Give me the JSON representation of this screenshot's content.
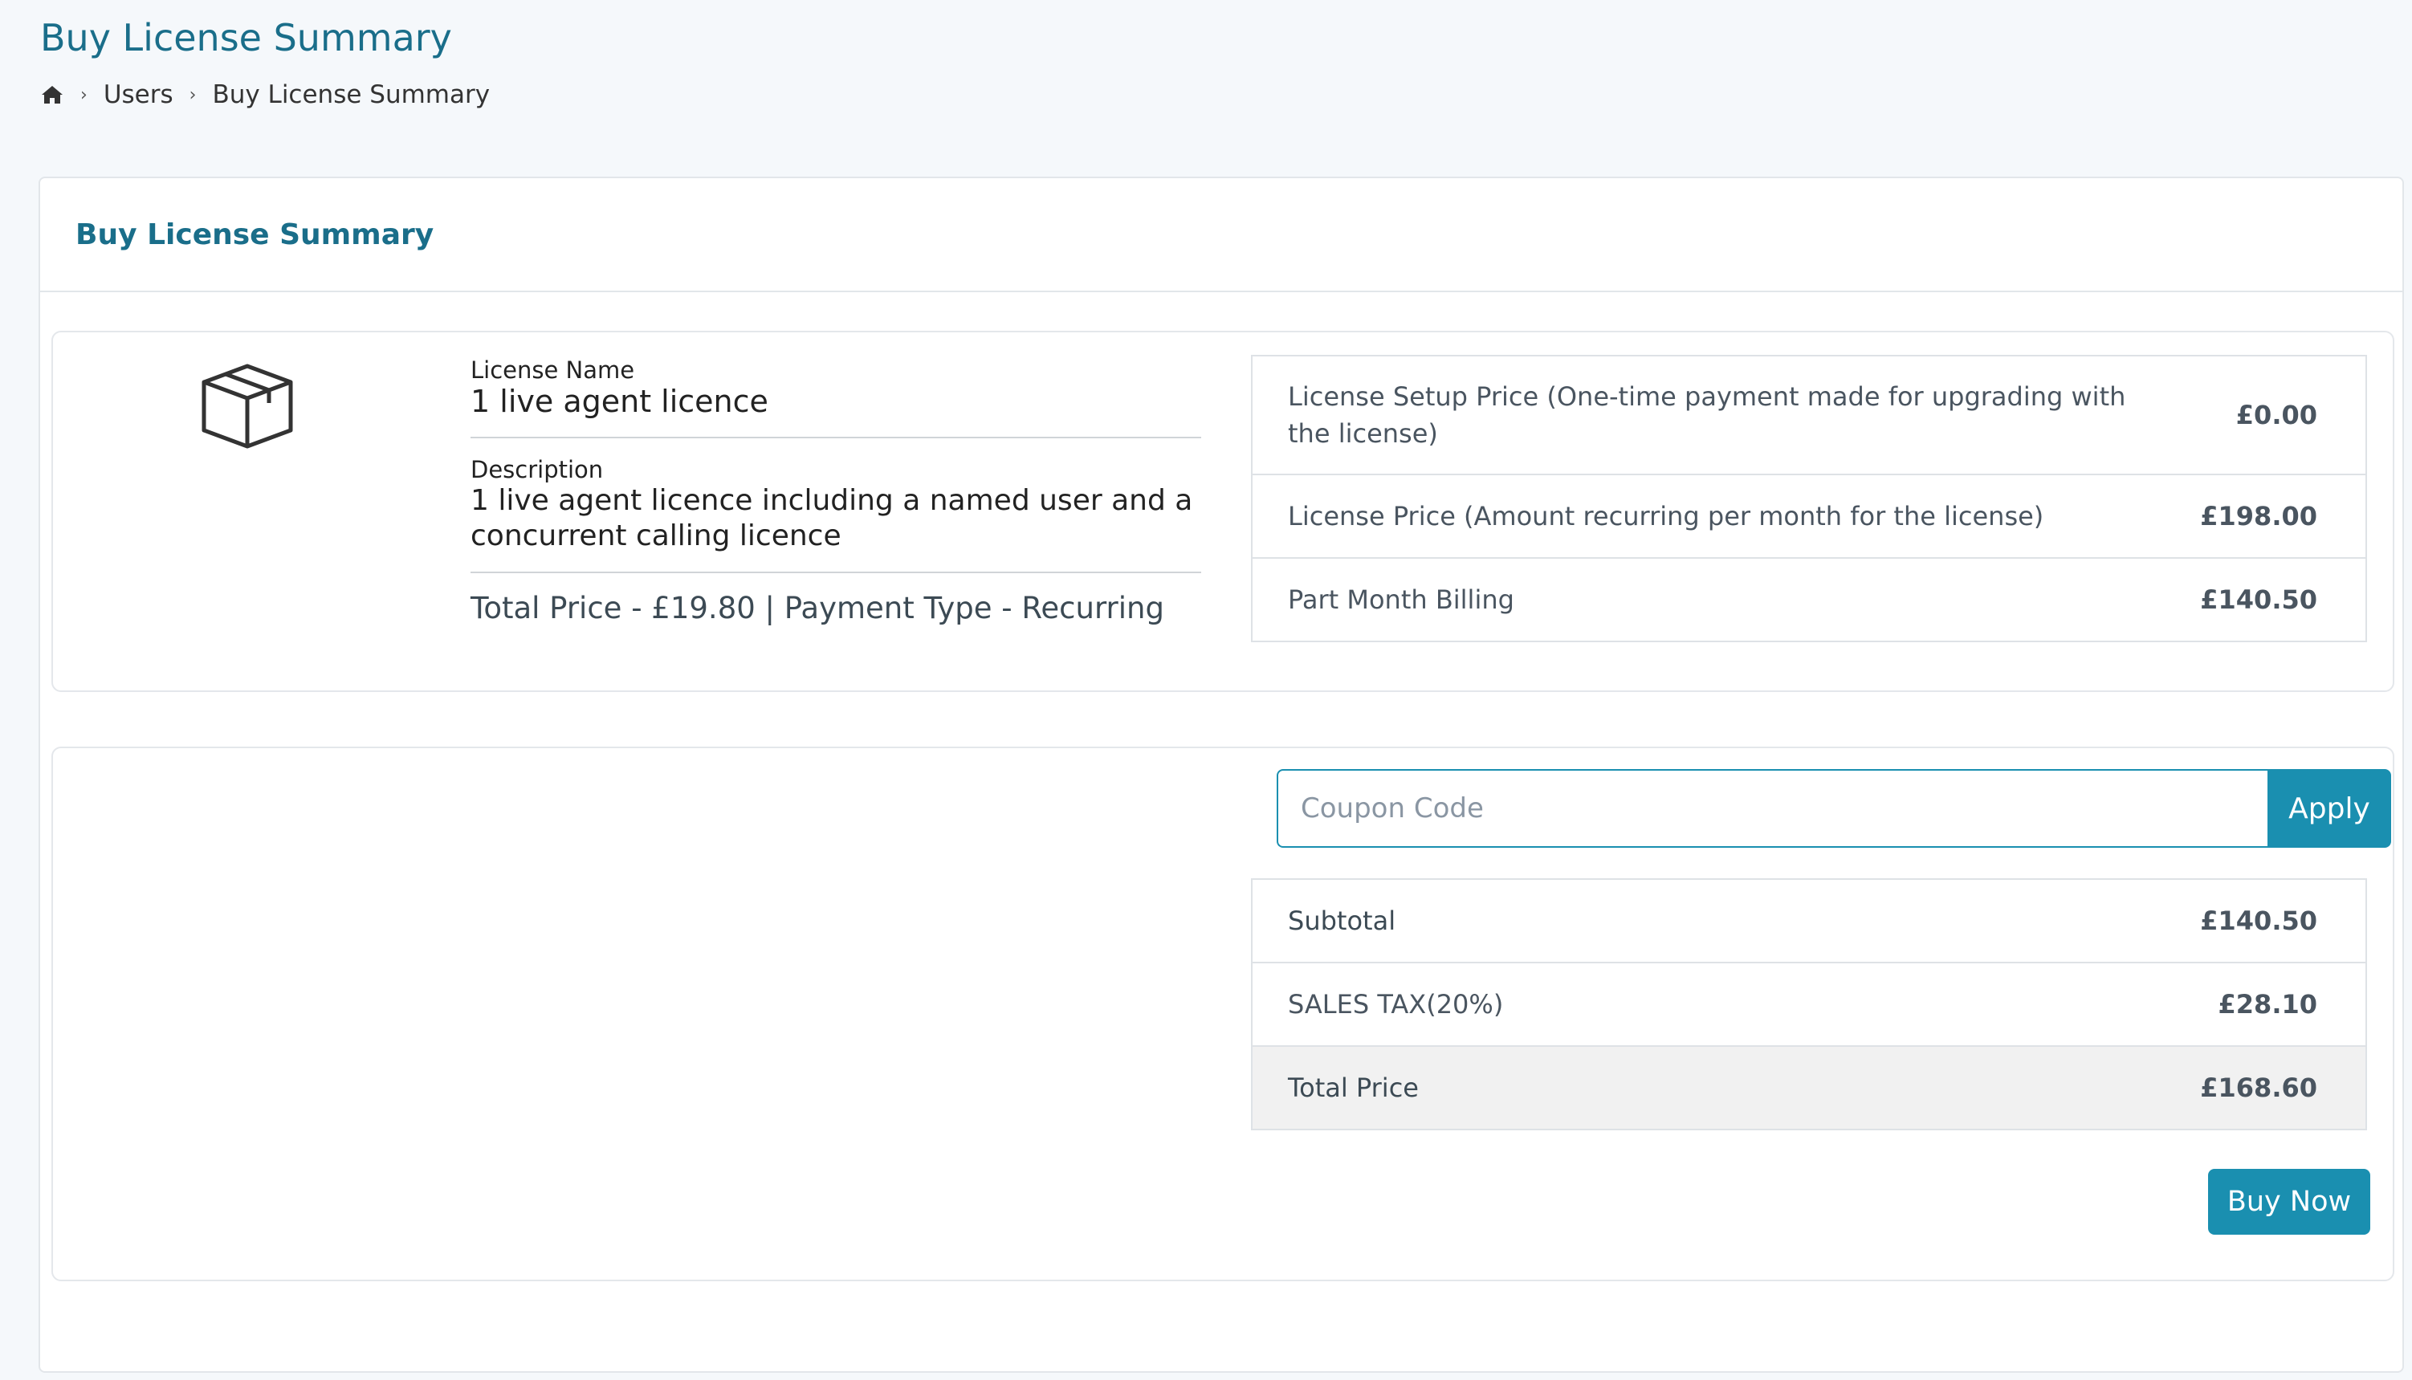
{
  "page": {
    "title": "Buy License Summary",
    "breadcrumb": {
      "home_icon": "home-icon",
      "items": [
        "Users",
        "Buy License Summary"
      ]
    }
  },
  "card": {
    "header": "Buy License Summary"
  },
  "license": {
    "icon": "package-box-icon",
    "name_label": "License Name",
    "name": "1 live agent licence",
    "description_label": "Description",
    "description": "1 live agent licence including a named user and a concurrent calling licence",
    "total_price_label": "Total Price",
    "total_price_value": " - £19.80 | ",
    "payment_type_label": "Payment Type",
    "payment_type_value": " - Recurring"
  },
  "pricing": [
    {
      "label": "License Setup Price (One-time payment made for upgrading with the license)",
      "value": "£0.00"
    },
    {
      "label": "License Price (Amount recurring per month for the license)",
      "value": "£198.00"
    },
    {
      "label": "Part Month Billing",
      "value": "£140.50"
    }
  ],
  "coupon": {
    "placeholder": "Coupon Code",
    "value": "",
    "apply_label": "Apply"
  },
  "summary": {
    "subtotal_label": "Subtotal",
    "subtotal_value": "£140.50",
    "tax_label": "SALES TAX(20%)",
    "tax_value": "£28.10",
    "total_label": "Total Price",
    "total_value": "£168.60"
  },
  "buy_now_label": "Buy Now",
  "colors": {
    "accent": "#1a8fb0",
    "title": "#1a6e8a"
  }
}
